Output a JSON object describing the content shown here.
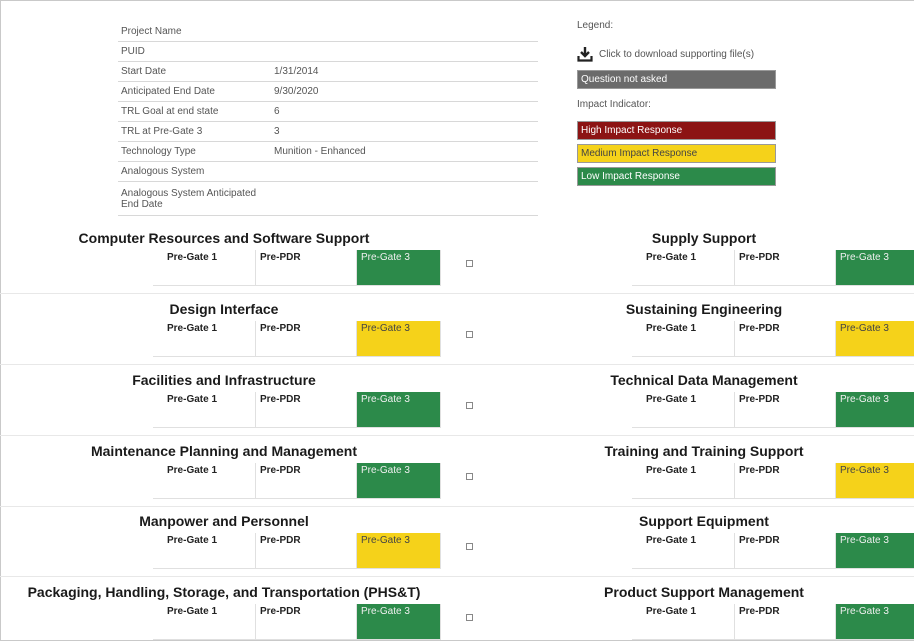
{
  "info": [
    {
      "label": "Project Name",
      "value": ""
    },
    {
      "label": "PUID",
      "value": ""
    },
    {
      "label": "Start Date",
      "value": "1/31/2014"
    },
    {
      "label": "Anticipated End Date",
      "value": "9/30/2020"
    },
    {
      "label": "TRL Goal at end state",
      "value": "6"
    },
    {
      "label": "TRL at Pre-Gate 3",
      "value": "3"
    },
    {
      "label": "Technology Type",
      "value": "Munition - Enhanced"
    },
    {
      "label": "Analogous System",
      "value": ""
    },
    {
      "label": "Analogous System Anticipated End Date",
      "value": ""
    }
  ],
  "legend": {
    "title": "Legend:",
    "download_label": "Click to download supporting file(s)",
    "not_asked": "Question not asked",
    "impact_title": "Impact Indicator:",
    "high": "High Impact Response",
    "medium": "Medium Impact Response",
    "low": "Low Impact Response"
  },
  "gate_labels": {
    "g1": "Pre-Gate 1",
    "g2": "Pre-PDR",
    "g3": "Pre-Gate 3",
    "expand": "⊞"
  },
  "colors": {
    "green": "#2c8a4a",
    "yellow": "#f5d21a",
    "red": "#8c1414",
    "gray": "#6b6b6b"
  },
  "sections_left": [
    {
      "title": "Computer Resources and Software Support",
      "status": "green"
    },
    {
      "title": "Design Interface",
      "status": "yellow"
    },
    {
      "title": "Facilities and Infrastructure",
      "status": "green"
    },
    {
      "title": "Maintenance Planning and Management",
      "status": "green"
    },
    {
      "title": "Manpower and Personnel",
      "status": "yellow"
    },
    {
      "title": "Packaging, Handling, Storage, and Transportation (PHS&T)",
      "status": "green"
    }
  ],
  "sections_right": [
    {
      "title": "Supply Support",
      "status": "green"
    },
    {
      "title": "Sustaining Engineering",
      "status": "yellow"
    },
    {
      "title": "Technical Data Management",
      "status": "green"
    },
    {
      "title": "Training and Training Support",
      "status": "yellow"
    },
    {
      "title": "Support Equipment",
      "status": "green"
    },
    {
      "title": "Product Support Management",
      "status": "green"
    }
  ]
}
